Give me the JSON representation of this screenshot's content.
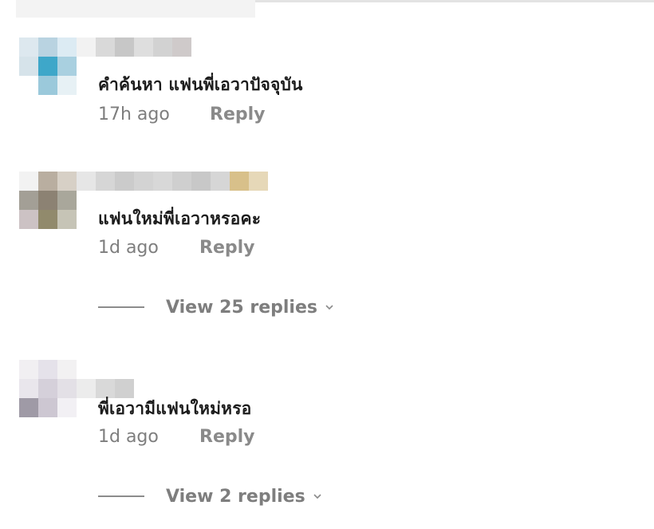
{
  "comments": [
    {
      "text": "คำค้นหา แฟนพี่เอวาปัจจุบัน",
      "time": "17h ago",
      "reply_label": "Reply",
      "avatar_colors": [
        [
          "#dde8ef",
          "#b9d3e1",
          "#dcebf3",
          "#f2f2f2",
          "#d9d9d9",
          "#c7c7c7",
          "#dedede",
          "#d2d2d2",
          "#cfcaca"
        ],
        [
          "#d6e3ea",
          "#3ea7c9",
          "#a9d0e0",
          "#ffffff",
          "#ffffff",
          "#ffffff",
          "#ffffff",
          "#ffffff",
          "#ffffff"
        ],
        [
          "#ffffff",
          "#9bc9db",
          "#e7f1f5",
          "#ffffff",
          "#ffffff",
          "#ffffff",
          "#ffffff",
          "#ffffff",
          "#ffffff"
        ]
      ]
    },
    {
      "text": "แฟนใหม่พี่เอวาหรอคะ",
      "time": "1d ago",
      "reply_label": "Reply",
      "avatar_colors": [
        [
          "#f2f2f2",
          "#b9aea0",
          "#d7d0c6",
          "#e6e6e6",
          "#d6d6d6",
          "#cbcbcb",
          "#d3d3d3",
          "#d8d8d8",
          "#cfcfcf",
          "#c8c8c8",
          "#d6d6d6",
          "#d8c08a",
          "#e6d8b8"
        ],
        [
          "#a39f96",
          "#8c8273",
          "#a9a79b",
          "#ffffff",
          "#ffffff",
          "#ffffff",
          "#ffffff",
          "#ffffff",
          "#ffffff",
          "#ffffff",
          "#ffffff",
          "#ffffff",
          "#ffffff"
        ],
        [
          "#ccc2c4",
          "#918a6c",
          "#c6c4b6",
          "#ffffff",
          "#ffffff",
          "#ffffff",
          "#ffffff",
          "#ffffff",
          "#ffffff",
          "#ffffff",
          "#ffffff",
          "#ffffff",
          "#ffffff"
        ]
      ],
      "view_replies": "View 25 replies"
    },
    {
      "text": "พี่เอวามีแฟนใหม่หรอ",
      "time": "1d ago",
      "reply_label": "Reply",
      "avatar_colors": [
        [
          "#f1eff2",
          "#e5e2ea",
          "#f2f1f2",
          "#ffffff",
          "#ffffff",
          "#ffffff"
        ],
        [
          "#e9e6ec",
          "#d5d0da",
          "#e3e0e6",
          "#ececec",
          "#d9d9d9",
          "#d0d0d0"
        ],
        [
          "#9f9aa6",
          "#cdc7d2",
          "#f2f0f4",
          "#ffffff",
          "#ffffff",
          "#ffffff"
        ]
      ],
      "view_replies": "View 2 replies"
    }
  ]
}
